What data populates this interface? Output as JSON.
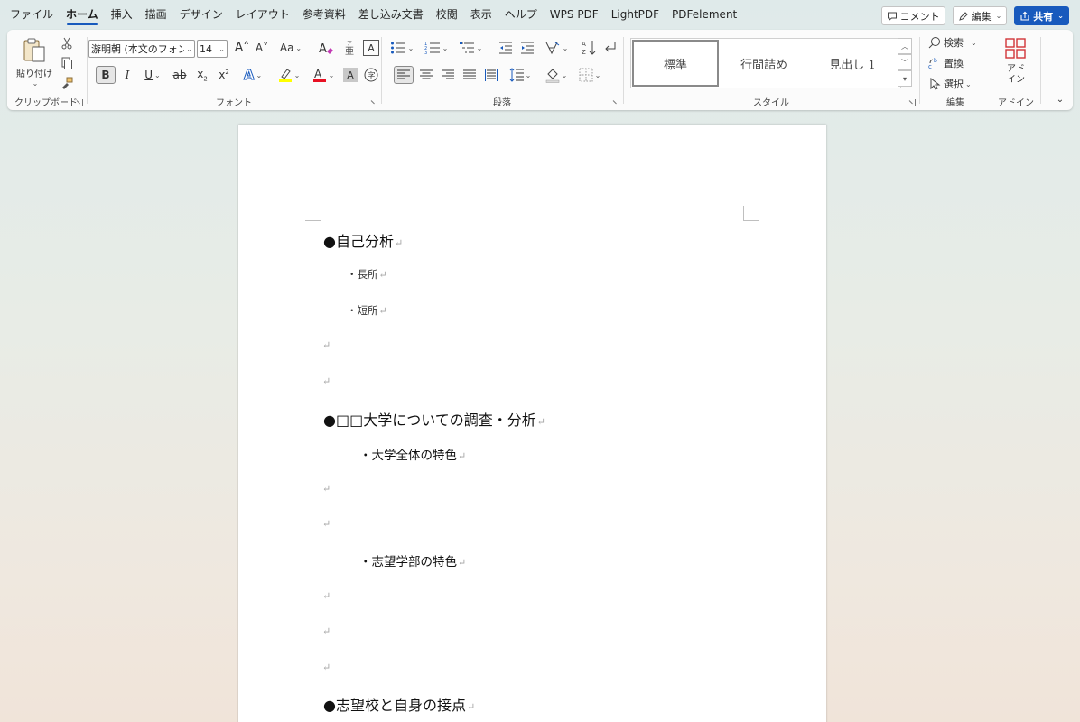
{
  "menu": {
    "tabs": [
      "ファイル",
      "ホーム",
      "挿入",
      "描画",
      "デザイン",
      "レイアウト",
      "参考資料",
      "差し込み文書",
      "校閲",
      "表示",
      "ヘルプ",
      "WPS PDF",
      "LightPDF",
      "PDFelement"
    ],
    "active_tab": "ホーム",
    "comment_label": "コメント",
    "edit_label": "編集",
    "share_label": "共有"
  },
  "clipboard": {
    "paste_label": "貼り付け",
    "group_label": "クリップボード"
  },
  "font": {
    "font_name": "游明朝 (本文のフォント",
    "font_size": "14",
    "case_label": "Aa",
    "group_label": "フォント"
  },
  "paragraph": {
    "group_label": "段落"
  },
  "styles": {
    "items": [
      "標準",
      "行間詰め",
      "見出し 1"
    ],
    "group_label": "スタイル"
  },
  "editing": {
    "search_label": "検索",
    "replace_label": "置換",
    "select_label": "選択",
    "group_label": "編集"
  },
  "addins": {
    "button_label_line1": "アド",
    "button_label_line2": "イン",
    "group_label": "アドイン"
  },
  "document": {
    "heading1": "●自己分析",
    "item1": "・長所",
    "item2": "・短所",
    "heading2": "●□□大学についての調査・分析",
    "item3": "・大学全体の特色",
    "item4": "・志望学部の特色",
    "heading3": "●志望校と自身の接点",
    "paragraph_mark": "↵"
  },
  "colors": {
    "accent": "#185abd",
    "highlight": "#ffff00",
    "font_color": "#e81123"
  }
}
